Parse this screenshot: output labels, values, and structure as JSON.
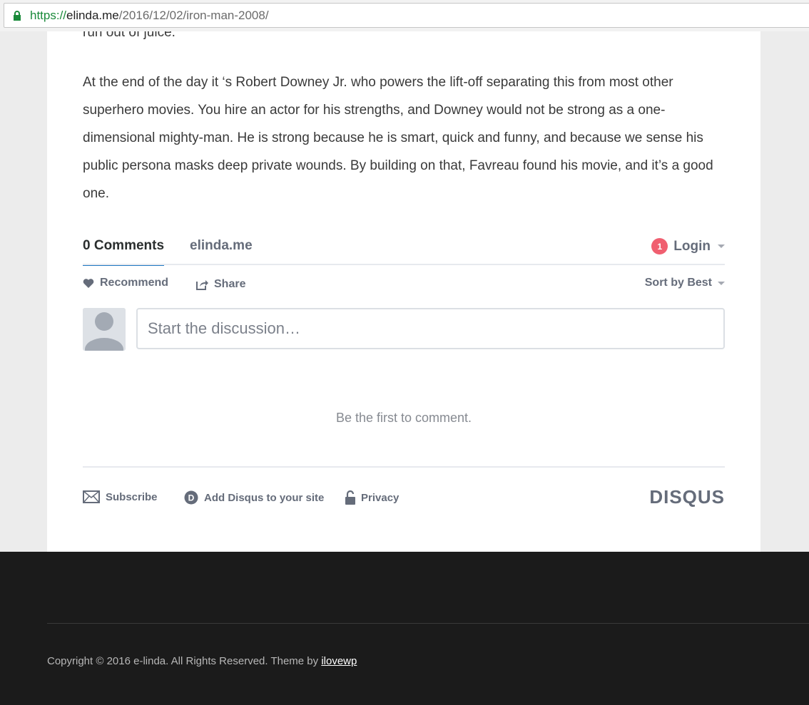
{
  "browser": {
    "url_scheme": "https://",
    "url_host": "elinda.me",
    "url_path": "/2016/12/02/iron-man-2008/"
  },
  "article": {
    "cut_line": "run out of juice.",
    "paragraph": "At the end of the day it ‘s Robert Downey Jr. who powers the lift-off separating this from most other superhero movies. You hire an actor for his strengths, and Downey would not be strong as a one-dimensional mighty-man. He is strong because he is smart, quick and funny, and because we sense his public persona masks deep private wounds. By building on that, Favreau found his movie, and it’s a good one."
  },
  "disqus": {
    "tabs": {
      "comments": "0 Comments",
      "site": "elinda.me"
    },
    "login": {
      "badge": "1",
      "label": "Login"
    },
    "actions": {
      "recommend": "Recommend",
      "share": "Share",
      "sort": "Sort by Best"
    },
    "comment_placeholder": "Start the discussion…",
    "empty_message": "Be the first to comment.",
    "footer": {
      "subscribe": "Subscribe",
      "add_disqus": "Add Disqus to your site",
      "privacy": "Privacy",
      "logo": "DISQUS"
    }
  },
  "site_footer": {
    "copyright": "Copyright © 2016 e-linda. All Rights Reserved. Theme by ",
    "theme_link": "ilovewp"
  },
  "colors": {
    "accent_tab_underline": "#1d77c2",
    "badge": "#f05f70",
    "footer_bg": "#1b1b1b"
  }
}
